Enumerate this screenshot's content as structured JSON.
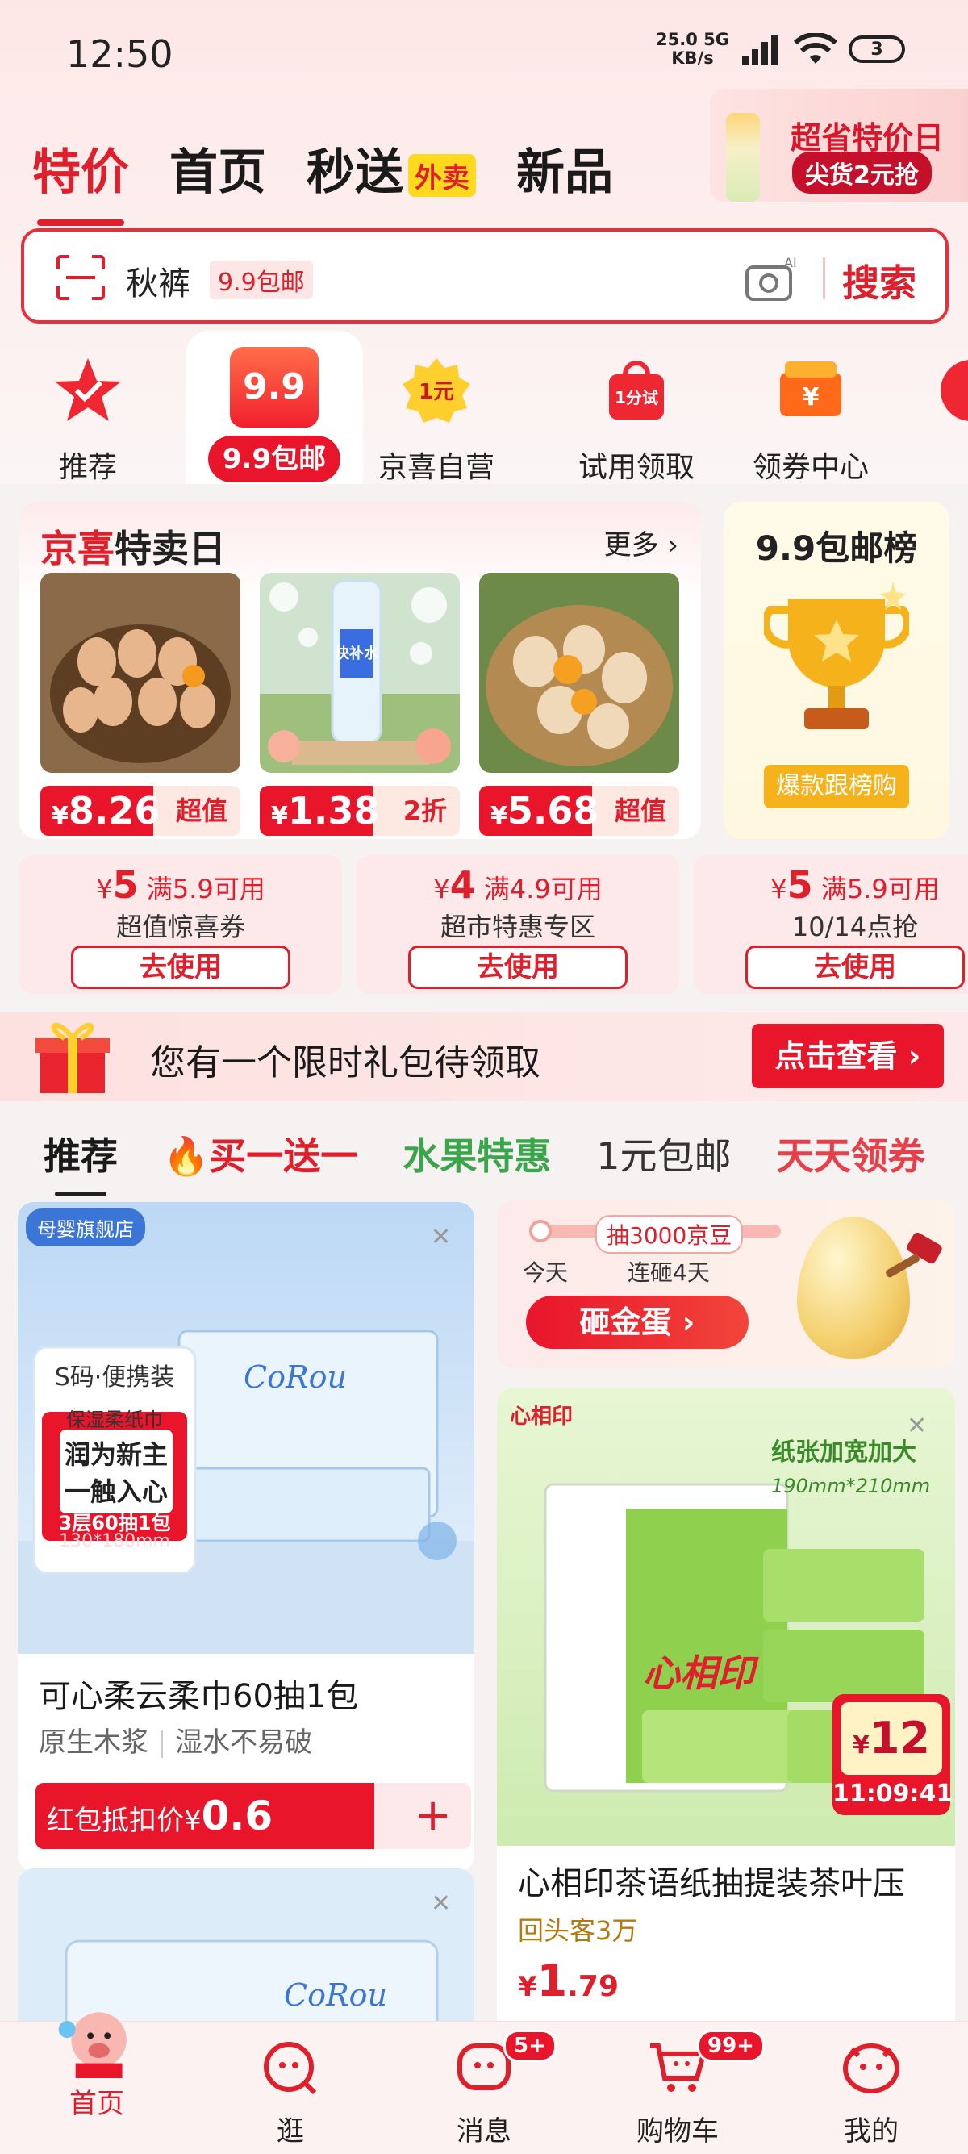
{
  "status_bar": {
    "time": "12:50",
    "net_speed": "25.0",
    "net_unit": "KB/s",
    "net_type": "5G",
    "battery": "3"
  },
  "top_nav": {
    "tabs": [
      "特价",
      "首页",
      "秒送",
      "新品"
    ],
    "waimai_badge": "外卖",
    "active": "特价"
  },
  "promo": {
    "title": "超省特价日",
    "subtitle": "尖货2元抢"
  },
  "search": {
    "keyword": "秋裤",
    "tag": "9.9包邮",
    "button": "搜索"
  },
  "categories": [
    {
      "label": "推荐",
      "icon": "star-check-icon"
    },
    {
      "label": "9.9包邮",
      "badge": "9.9",
      "icon": "99-bag-icon"
    },
    {
      "label": "京喜自营",
      "badge": "1元",
      "icon": "one-yuan-icon"
    },
    {
      "label": "试用领取",
      "badge": "1分试",
      "icon": "trial-bag-icon"
    },
    {
      "label": "领券中心",
      "badge": "¥",
      "icon": "coupon-icon"
    }
  ],
  "special": {
    "title_red": "京喜",
    "title_black": "特卖日",
    "more": "更多 ›",
    "products": [
      {
        "currency": "¥",
        "price": "8.26",
        "tag": "超值",
        "image": "eggs-basket"
      },
      {
        "currency": "¥",
        "price": "1.38",
        "tag": "2折",
        "image": "water-bottle",
        "label": "快补水"
      },
      {
        "currency": "¥",
        "price": "5.68",
        "tag": "超值",
        "image": "eggs-basket-open"
      }
    ]
  },
  "rank": {
    "title": "9.9包邮榜",
    "button": "爆款跟榜购"
  },
  "coupons": [
    {
      "amount": "5",
      "condition": "满5.9可用",
      "desc": "超值惊喜券",
      "button": "去使用"
    },
    {
      "amount": "4",
      "condition": "满4.9可用",
      "desc": "超市特惠专区",
      "button": "去使用"
    },
    {
      "amount": "5",
      "condition": "满5.9可用",
      "desc": "10/14点抢",
      "button": "去使用"
    }
  ],
  "gift": {
    "text": "您有一个限时礼包待领取",
    "button": "点击查看 ›"
  },
  "feed_tabs": [
    "推荐",
    "买一送一",
    "水果特惠",
    "1元包邮",
    "天天领券"
  ],
  "feed_left": {
    "store": "母婴旗舰店",
    "brand": "CoRou",
    "brand_cn": "可心柔",
    "size_tag": "S码·便携装",
    "panel_top": "保湿柔纸巾",
    "panel_main": "润为新主 一触入心",
    "panel_count": "3层60抽1包",
    "panel_size": "130*180mm",
    "title": "可心柔云柔巾60抽1包",
    "sub1": "原生木浆",
    "sub2": "湿水不易破",
    "redpack_label": "红包抵扣价",
    "currency": "¥",
    "redpack_price": "0.6",
    "plus": "+"
  },
  "egg": {
    "chip": "抽3000京豆",
    "today": "今天",
    "days": "连砸4天",
    "button": "砸金蛋 ›"
  },
  "feed_right": {
    "brand": "心相印",
    "banner": "纸张加宽加大",
    "banner_size": "190mm*210mm",
    "currency": "¥",
    "flash_price": "12",
    "flash_time": "11:09:41",
    "title": "心相印茶语纸抽提装茶叶压",
    "repeat": "回头客3万",
    "price_int": "1",
    "price_dec": ".79"
  },
  "bottom_nav": [
    {
      "label": "首页",
      "icon": "mascot-icon"
    },
    {
      "label": "逛",
      "icon": "browse-icon"
    },
    {
      "label": "消息",
      "icon": "message-icon",
      "badge": "5+"
    },
    {
      "label": "购物车",
      "icon": "cart-icon",
      "badge": "99+"
    },
    {
      "label": "我的",
      "icon": "profile-icon"
    }
  ],
  "colors": {
    "accent": "#e01f2c",
    "green": "#3aa54a",
    "gold": "#f6b21a"
  }
}
